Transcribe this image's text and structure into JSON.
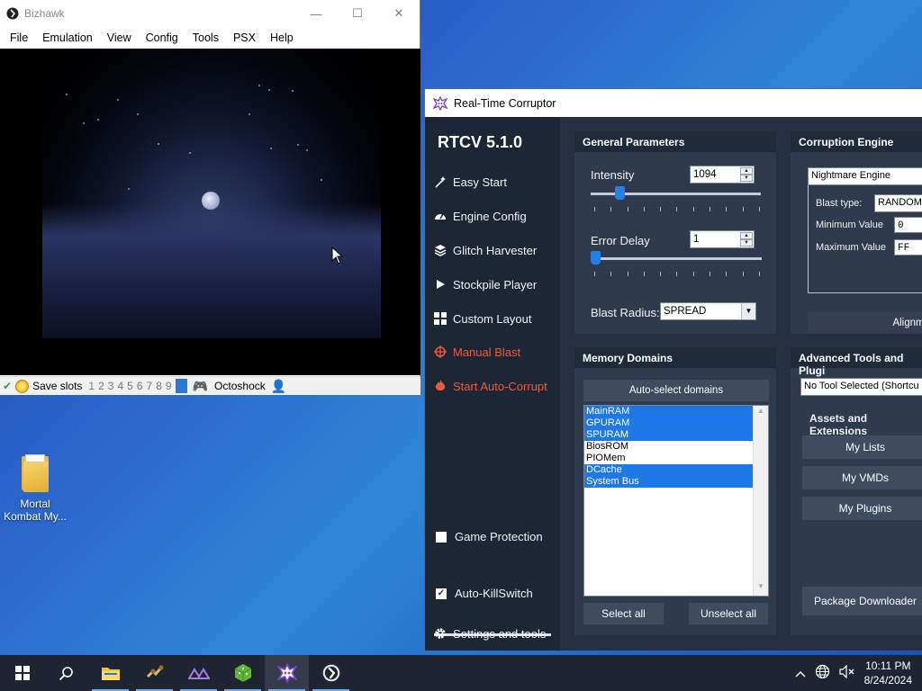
{
  "bizhawk": {
    "title": "Bizhawk",
    "menu": [
      "File",
      "Emulation",
      "View",
      "Config",
      "Tools",
      "PSX",
      "Help"
    ],
    "status": {
      "save_slots_label": "Save slots",
      "slots": [
        "1",
        "2",
        "3",
        "4",
        "5",
        "6",
        "7",
        "8",
        "9"
      ],
      "core": "Octoshock"
    }
  },
  "desktop": {
    "icon_label_line1": "Mortal",
    "icon_label_line2": "Kombat My..."
  },
  "rtc": {
    "title": "Real-Time Corruptor",
    "version": "RTCV 5.1.0",
    "nav": {
      "easy_start": "Easy Start",
      "engine_config": "Engine Config",
      "glitch_harvester": "Glitch Harvester",
      "stockpile_player": "Stockpile Player",
      "custom_layout": "Custom Layout",
      "manual_blast": "Manual Blast",
      "auto_corrupt": "Start Auto-Corrupt",
      "game_protection": "Game Protection",
      "auto_killswitch": "Auto-KillSwitch",
      "settings": "Settings and tools"
    },
    "accent_red": "#f05a3c",
    "general": {
      "header": "General Parameters",
      "intensity_label": "Intensity",
      "intensity_value": "1094",
      "intensity_slider_fraction": 0.15,
      "error_delay_label": "Error Delay",
      "error_delay_value": "1",
      "error_delay_slider_fraction": 0.0,
      "blast_radius_label": "Blast Radius:",
      "blast_radius_value": "SPREAD"
    },
    "engine": {
      "header": "Corruption Engine",
      "engine_name": "Nightmare Engine",
      "blast_type_label": "Blast type:",
      "blast_type_value": "RANDOM",
      "min_label": "Minimum Value",
      "min_value": "0",
      "max_label": "Maximum Value",
      "max_value": "FF",
      "alignment_label": "Alignme"
    },
    "memory": {
      "header": "Memory Domains",
      "autoselect": "Auto-select domains",
      "domains": [
        {
          "name": "MainRAM",
          "selected": true
        },
        {
          "name": "GPURAM",
          "selected": true
        },
        {
          "name": "SPURAM",
          "selected": true
        },
        {
          "name": "BiosROM",
          "selected": false
        },
        {
          "name": "PIOMem",
          "selected": false
        },
        {
          "name": "DCache",
          "selected": true
        },
        {
          "name": "System Bus",
          "selected": true
        }
      ],
      "select_all": "Select all",
      "unselect_all": "Unselect all",
      "selection_color": "#1e78e6"
    },
    "tools": {
      "header": "Advanced Tools and Plugi",
      "tool_select": "No Tool Selected (Shortcu",
      "assets_label": "Assets and Extensions",
      "my_lists": "My Lists",
      "my_vmds": "My VMDs",
      "my_plugins": "My Plugins",
      "package_downloader": "Package Downloader"
    }
  },
  "taskbar": {
    "time": "10:11 PM",
    "date": "8/24/2024"
  }
}
